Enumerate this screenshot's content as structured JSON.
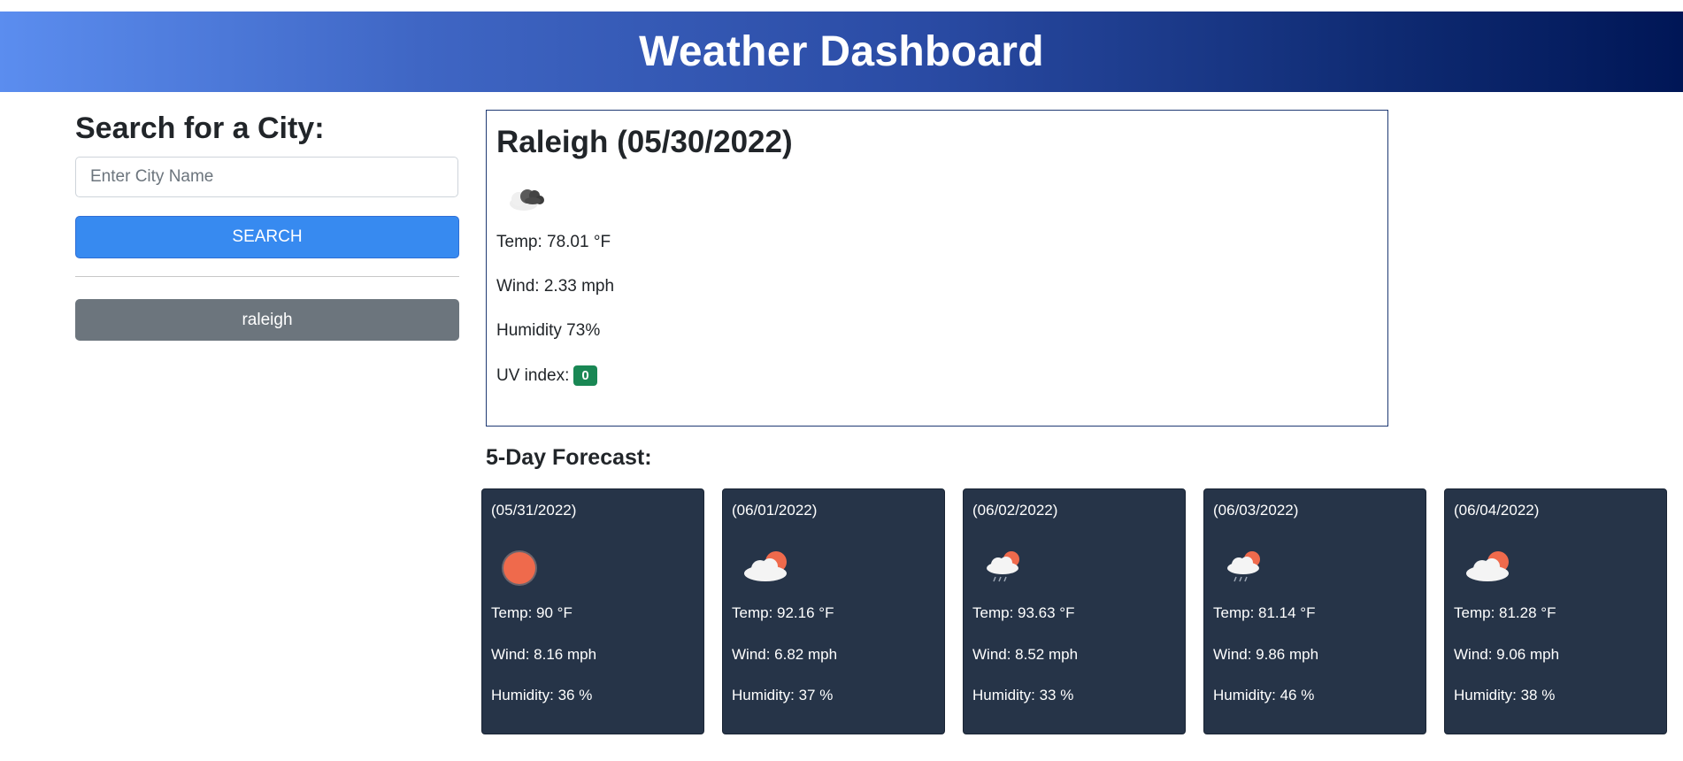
{
  "header": {
    "title": "Weather Dashboard"
  },
  "search": {
    "heading": "Search for a City:",
    "placeholder": "Enter City Name",
    "value": "",
    "button_label": "SEARCH"
  },
  "history": [
    {
      "label": "raleigh"
    }
  ],
  "current": {
    "title": "Raleigh (05/30/2022)",
    "icon": "broken-clouds-icon",
    "temp": "Temp: 78.01 °F",
    "wind": "Wind: 2.33 mph",
    "humidity": "Humidity 73%",
    "uv_label": "UV index:",
    "uv_value": "0",
    "uv_color": "#198754"
  },
  "forecast": {
    "heading": "5-Day Forecast:",
    "days": [
      {
        "date": "(05/31/2022)",
        "icon": "sun-icon",
        "temp": "Temp: 90 °F",
        "wind": "Wind: 8.16 mph",
        "humidity": "Humidity: 36 %"
      },
      {
        "date": "(06/01/2022)",
        "icon": "partly-cloudy-icon",
        "temp": "Temp: 92.16 °F",
        "wind": "Wind: 6.82 mph",
        "humidity": "Humidity: 37 %"
      },
      {
        "date": "(06/02/2022)",
        "icon": "rain-sun-icon",
        "temp": "Temp: 93.63 °F",
        "wind": "Wind: 8.52 mph",
        "humidity": "Humidity: 33 %"
      },
      {
        "date": "(06/03/2022)",
        "icon": "rain-sun-icon",
        "temp": "Temp: 81.14 °F",
        "wind": "Wind: 9.86 mph",
        "humidity": "Humidity: 46 %"
      },
      {
        "date": "(06/04/2022)",
        "icon": "partly-cloudy-icon",
        "temp": "Temp: 81.28 °F",
        "wind": "Wind: 9.06 mph",
        "humidity": "Humidity: 38 %"
      }
    ]
  },
  "colors": {
    "header_gradient_start": "#5b8def",
    "header_gradient_end": "#001656",
    "search_button": "#378af0",
    "history_button": "#6c757d",
    "forecast_card": "#263448",
    "sun": "#ef6a4c"
  }
}
